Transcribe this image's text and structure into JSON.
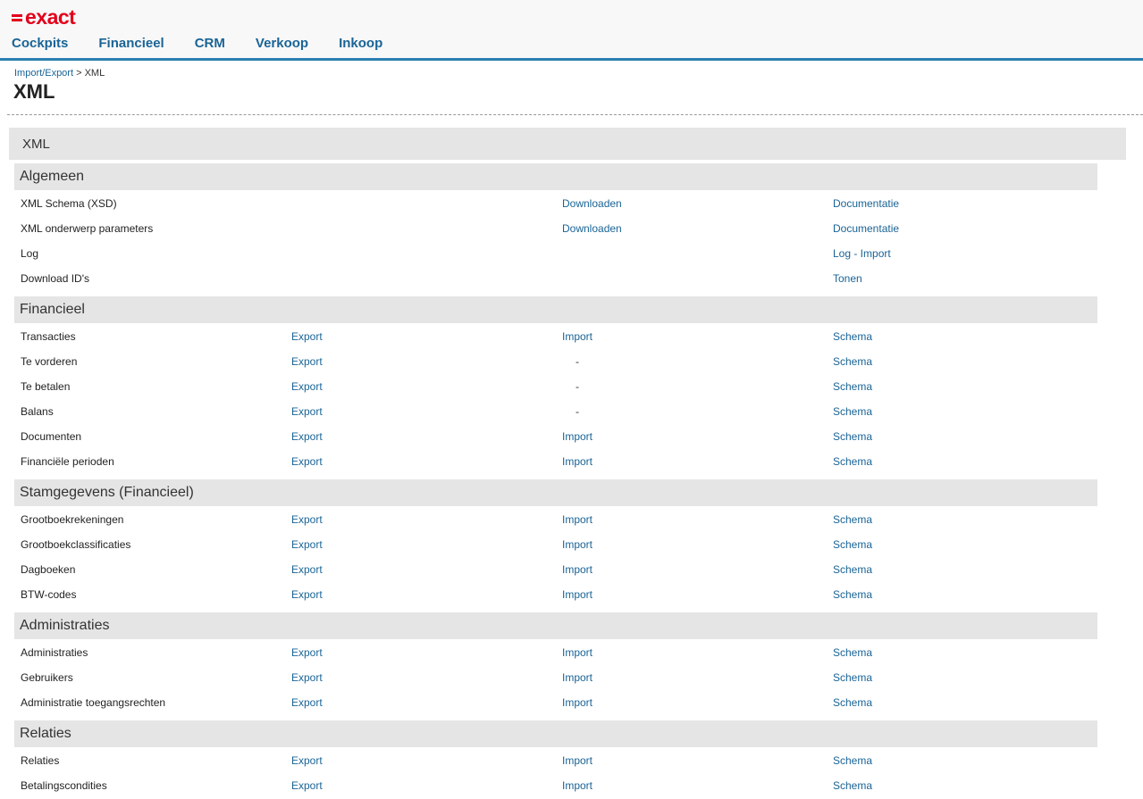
{
  "header": {
    "logo_text": "exact",
    "brand_color": "#e3001b",
    "accent_color": "#2a7fb0",
    "nav": [
      "Cockpits",
      "Financieel",
      "CRM",
      "Verkoop",
      "Inkoop"
    ]
  },
  "breadcrumb": {
    "parent": "Import/Export",
    "separator": " > ",
    "current": "XML"
  },
  "page_title": "XML",
  "panel_title": "XML",
  "sections": {
    "algemeen": {
      "title": "Algemeen",
      "rows": [
        {
          "name": "XML Schema (XSD)",
          "c3": "Downloaden",
          "c4": "Documentatie"
        },
        {
          "name": "XML onderwerp parameters",
          "c3": "Downloaden",
          "c4": "Documentatie"
        },
        {
          "name": "Log",
          "c4": "Log - Import"
        },
        {
          "name": "Download ID's",
          "c4": "Tonen"
        }
      ]
    },
    "financieel": {
      "title": "Financieel",
      "rows": [
        {
          "name": "Transacties",
          "c2": "Export",
          "c3": "Import",
          "c4": "Schema"
        },
        {
          "name": "Te vorderen",
          "c2": "Export",
          "c3": "-",
          "c4": "Schema"
        },
        {
          "name": "Te betalen",
          "c2": "Export",
          "c3": "-",
          "c4": "Schema"
        },
        {
          "name": "Balans",
          "c2": "Export",
          "c3": "-",
          "c4": "Schema"
        },
        {
          "name": "Documenten",
          "c2": "Export",
          "c3": "Import",
          "c4": "Schema"
        },
        {
          "name": "Financiële perioden",
          "c2": "Export",
          "c3": "Import",
          "c4": "Schema"
        }
      ]
    },
    "stamgegevens": {
      "title": "Stamgegevens (Financieel)",
      "rows": [
        {
          "name": "Grootboekrekeningen",
          "c2": "Export",
          "c3": "Import",
          "c4": "Schema"
        },
        {
          "name": "Grootboekclassificaties",
          "c2": "Export",
          "c3": "Import",
          "c4": "Schema"
        },
        {
          "name": "Dagboeken",
          "c2": "Export",
          "c3": "Import",
          "c4": "Schema"
        },
        {
          "name": "BTW-codes",
          "c2": "Export",
          "c3": "Import",
          "c4": "Schema"
        }
      ]
    },
    "administraties": {
      "title": "Administraties",
      "rows": [
        {
          "name": "Administraties",
          "c2": "Export",
          "c3": "Import",
          "c4": "Schema"
        },
        {
          "name": "Gebruikers",
          "c2": "Export",
          "c3": "Import",
          "c4": "Schema"
        },
        {
          "name": "Administratie toegangsrechten",
          "c2": "Export",
          "c3": "Import",
          "c4": "Schema"
        }
      ]
    },
    "relaties": {
      "title": "Relaties",
      "rows": [
        {
          "name": "Relaties",
          "c2": "Export",
          "c3": "Import",
          "c4": "Schema"
        },
        {
          "name": "Betalingscondities",
          "c2": "Export",
          "c3": "Import",
          "c4": "Schema"
        }
      ]
    }
  }
}
